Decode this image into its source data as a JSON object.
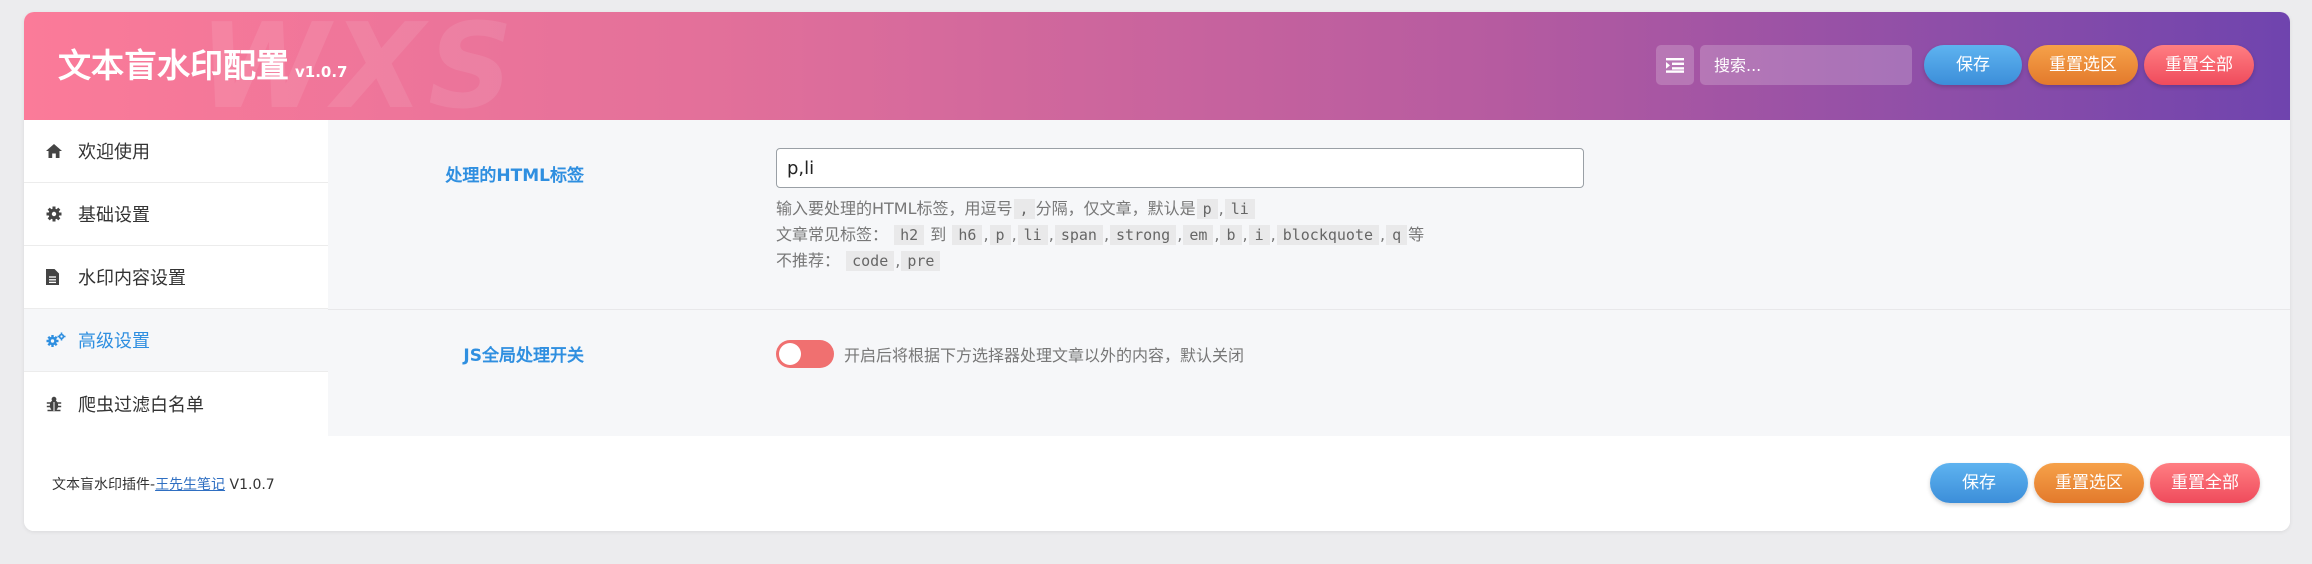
{
  "header": {
    "title": "文本盲水印配置",
    "version": "v1.0.7",
    "deco_text": "WXS",
    "search_placeholder": "搜索...",
    "menu_icon": "list-icon",
    "save_label": "保存",
    "reset_selection_label": "重置选区",
    "reset_all_label": "重置全部"
  },
  "sidebar": {
    "items": [
      {
        "label": "欢迎使用",
        "icon": "home-icon"
      },
      {
        "label": "基础设置",
        "icon": "gear-icon"
      },
      {
        "label": "水印内容设置",
        "icon": "document-icon"
      },
      {
        "label": "高级设置",
        "icon": "gears-icon",
        "active": true
      },
      {
        "label": "爬虫过滤白名单",
        "icon": "bug-icon"
      }
    ]
  },
  "main": {
    "html_tags": {
      "label": "处理的HTML标签",
      "value": "p,li",
      "help_line1_prefix": "输入要处理的HTML标签，用逗号",
      "help_line1_comma": ",",
      "help_line1_mid": "分隔，仅文章，默认是",
      "help_line1_defaults": [
        "p",
        "li"
      ],
      "help_line2_prefix": "文章常见标签：",
      "help_line2_h2": "h2",
      "help_line2_to": "到",
      "help_line2_h6": "h6",
      "help_line2_tags": [
        "p",
        "li",
        "span",
        "strong",
        "em",
        "b",
        "i",
        "blockquote",
        "q"
      ],
      "help_line2_suffix": "等",
      "help_line3_prefix": "不推荐：",
      "help_line3_tags": [
        "code",
        "pre"
      ]
    },
    "js_global": {
      "label": "JS全局处理开关",
      "enabled": false,
      "description": "开启后将根据下方选择器处理文章以外的内容，默认关闭"
    }
  },
  "footer": {
    "plugin_name": "文本盲水印插件-",
    "author_link": "王先生笔记",
    "version": "V1.0.7",
    "save_label": "保存",
    "reset_selection_label": "重置选区",
    "reset_all_label": "重置全部"
  },
  "colors": {
    "accent_blue": "#2f8fe0",
    "header_gradient_start": "#fb7b99",
    "header_gradient_end": "#6f44ae",
    "toggle_off": "#f07070"
  }
}
